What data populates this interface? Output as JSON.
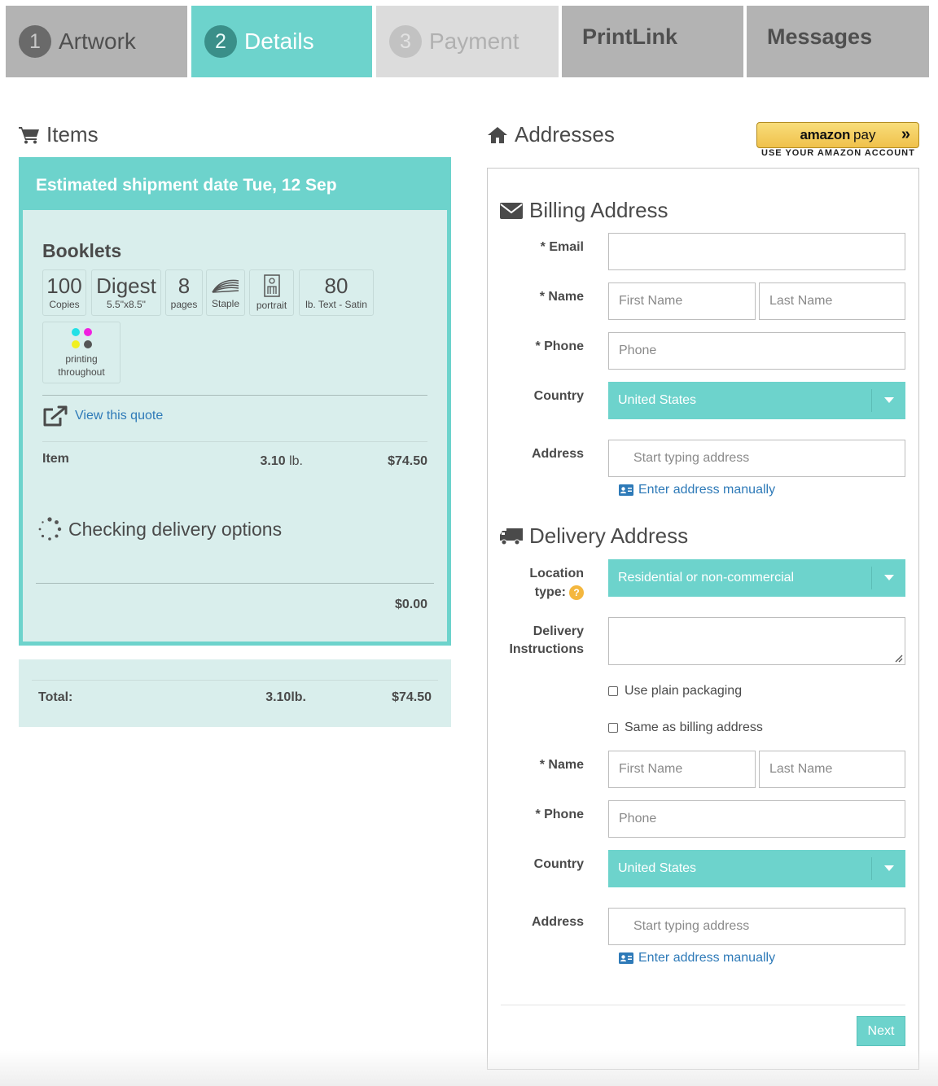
{
  "tabs": [
    {
      "num": "1",
      "label": "Artwork"
    },
    {
      "num": "2",
      "label": "Details"
    },
    {
      "num": "3",
      "label": "Payment"
    },
    {
      "num": "",
      "label": "PrintLink"
    },
    {
      "num": "",
      "label": "Messages"
    }
  ],
  "items": {
    "heading": "Items",
    "ship_banner": "Estimated shipment date Tue, 12 Sep",
    "product": "Booklets",
    "specs": [
      {
        "big": "100",
        "small": "Copies"
      },
      {
        "big": "Digest",
        "small": "5.5\"x8.5\""
      },
      {
        "big": "8",
        "small": "pages"
      },
      {
        "icon": "staple-icon",
        "small": "Staple"
      },
      {
        "icon": "portrait-icon",
        "small": "portrait"
      },
      {
        "big": "80",
        "small": "lb. Text - Satin"
      }
    ],
    "printing": {
      "line1": "printing",
      "line2": "throughout",
      "colors": [
        "#22e0e6",
        "#f020e0",
        "#f0f020",
        "#555555"
      ]
    },
    "view_quote": "View this quote",
    "item_row": {
      "label": "Item",
      "weight": "3.10",
      "weight_unit": "lb.",
      "price": "$74.50"
    },
    "checking": "Checking delivery options",
    "delivery_cost": "$0.00",
    "total": {
      "label": "Total:",
      "weight": "3.10lb.",
      "price": "$74.50"
    }
  },
  "addresses": {
    "heading": "Addresses",
    "amazon": {
      "logo": "amazon",
      "pay": "pay",
      "caption": "USE YOUR AMAZON ACCOUNT"
    },
    "billing": {
      "heading": "Billing Address",
      "email_label": "* Email",
      "name_label": "* Name",
      "first_placeholder": "First Name",
      "last_placeholder": "Last Name",
      "phone_label": "* Phone",
      "phone_placeholder": "Phone",
      "country_label": "Country",
      "country_value": "United States",
      "address_label": "Address",
      "address_placeholder": "Start typing address",
      "manual_link": "Enter address manually"
    },
    "delivery": {
      "heading": "Delivery Address",
      "location_label_1": "Location",
      "location_label_2": "type:",
      "location_value": "Residential or non-commercial",
      "instructions_label_1": "Delivery",
      "instructions_label_2": "Instructions",
      "plain_packaging": "Use plain packaging",
      "same_as_billing": "Same as billing address",
      "name_label": "* Name",
      "first_placeholder": "First Name",
      "last_placeholder": "Last Name",
      "phone_label": "* Phone",
      "phone_placeholder": "Phone",
      "country_label": "Country",
      "country_value": "United States",
      "address_label": "Address",
      "address_placeholder": "Start typing address",
      "manual_link": "Enter address manually"
    },
    "next": "Next"
  },
  "colors": {
    "accent": "#6dd3cc",
    "panel": "#d9eeec",
    "link": "#2e7ab8",
    "help": "#f4b73e"
  }
}
